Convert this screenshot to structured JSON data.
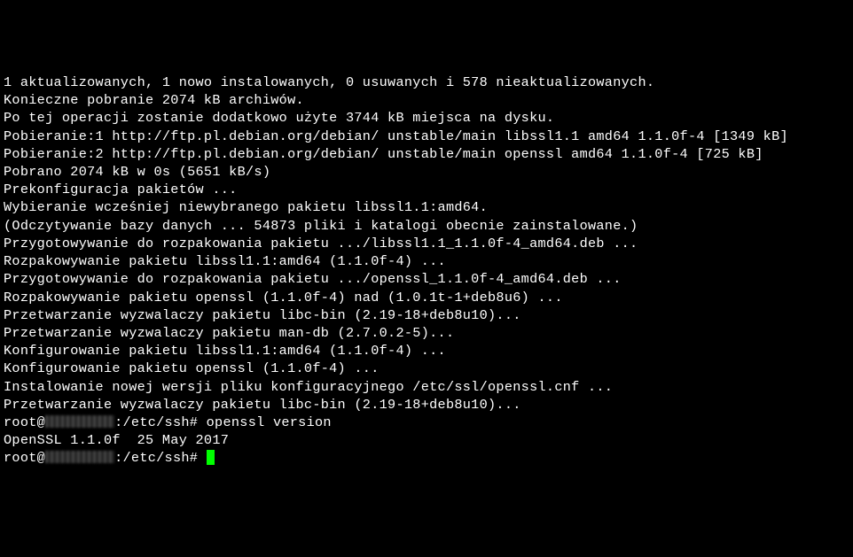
{
  "lines": [
    "1 aktualizowanych, 1 nowo instalowanych, 0 usuwanych i 578 nieaktualizowanych.",
    "Konieczne pobranie 2074 kB archiwów.",
    "Po tej operacji zostanie dodatkowo użyte 3744 kB miejsca na dysku.",
    "Pobieranie:1 http://ftp.pl.debian.org/debian/ unstable/main libssl1.1 amd64 1.1.0f-4 [1349 kB]",
    "Pobieranie:2 http://ftp.pl.debian.org/debian/ unstable/main openssl amd64 1.1.0f-4 [725 kB]",
    "Pobrano 2074 kB w 0s (5651 kB/s)",
    "Prekonfiguracja pakietów ...",
    "Wybieranie wcześniej niewybranego pakietu libssl1.1:amd64.",
    "(Odczytywanie bazy danych ... 54873 pliki i katalogi obecnie zainstalowane.)",
    "Przygotowywanie do rozpakowania pakietu .../libssl1.1_1.1.0f-4_amd64.deb ...",
    "Rozpakowywanie pakietu libssl1.1:amd64 (1.1.0f-4) ...",
    "Przygotowywanie do rozpakowania pakietu .../openssl_1.1.0f-4_amd64.deb ...",
    "Rozpakowywanie pakietu openssl (1.1.0f-4) nad (1.0.1t-1+deb8u6) ...",
    "Przetwarzanie wyzwalaczy pakietu libc-bin (2.19-18+deb8u10)...",
    "Przetwarzanie wyzwalaczy pakietu man-db (2.7.0.2-5)...",
    "Konfigurowanie pakietu libssl1.1:amd64 (1.1.0f-4) ...",
    "Konfigurowanie pakietu openssl (1.1.0f-4) ...",
    "Instalowanie nowej wersji pliku konfiguracyjnego /etc/ssl/openssl.cnf ...",
    "Przetwarzanie wyzwalaczy pakietu libc-bin (2.19-18+deb8u10)..."
  ],
  "prompt1": {
    "user": "root@",
    "path": ":/etc/ssh#",
    "command": " openssl version"
  },
  "openssl_output": "OpenSSL 1.1.0f  25 May 2017",
  "prompt2": {
    "user": "root@",
    "path": ":/etc/ssh#",
    "command": " "
  }
}
